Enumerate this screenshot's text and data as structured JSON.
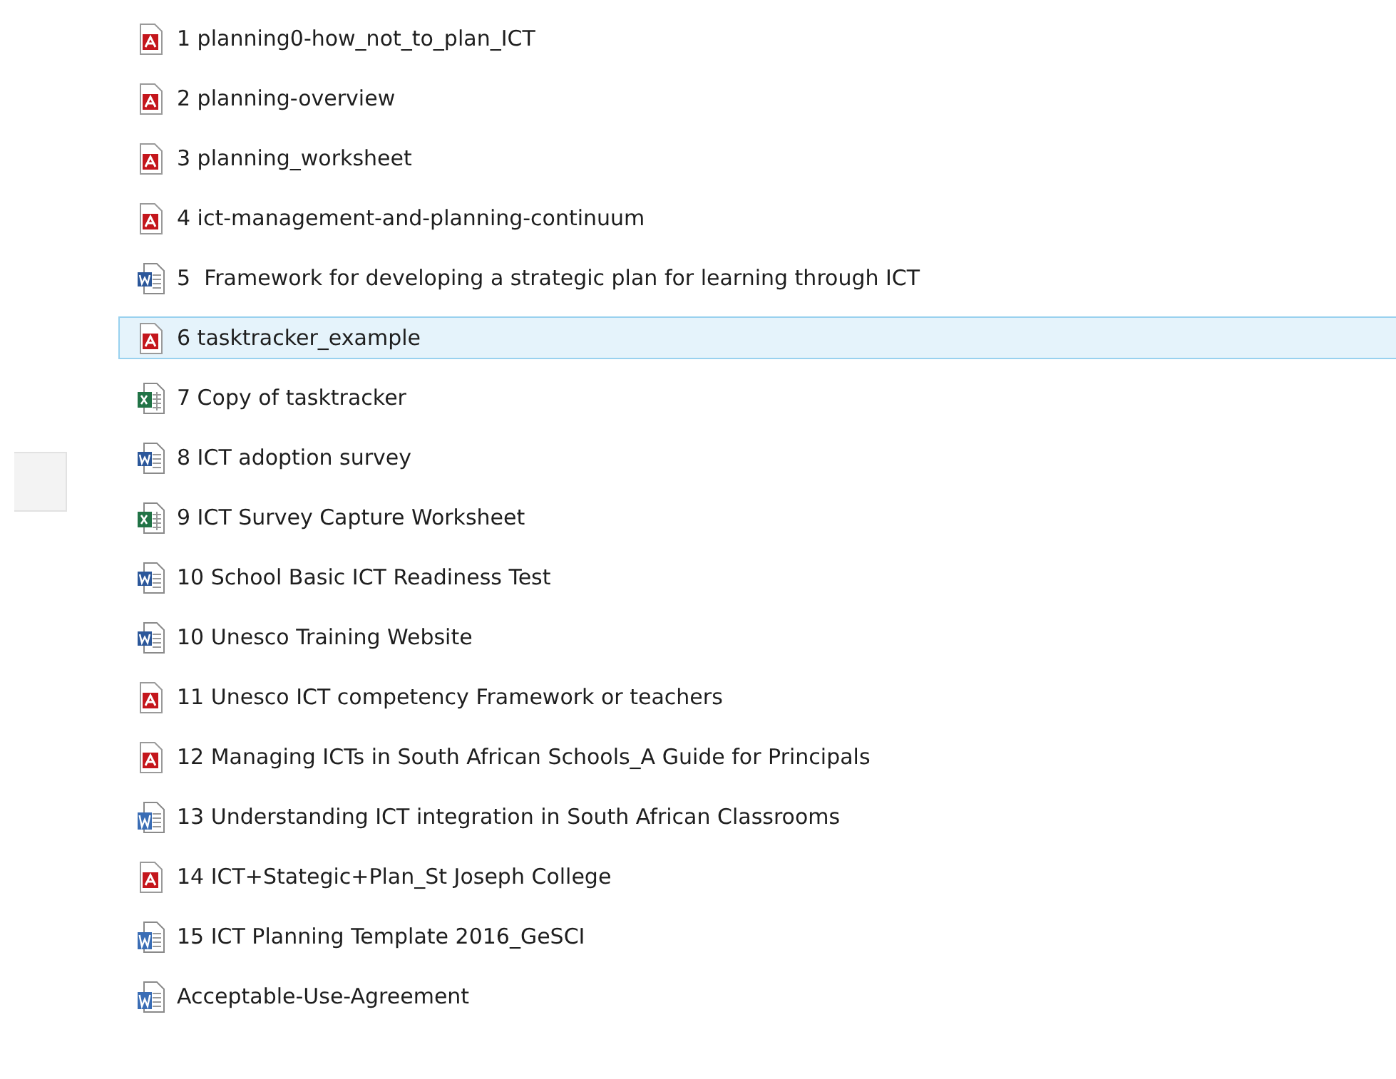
{
  "files": [
    {
      "name": "1 planning0-how_not_to_plan_ICT",
      "kind": "pdf",
      "selected": false
    },
    {
      "name": "2 planning-overview",
      "kind": "pdf",
      "selected": false
    },
    {
      "name": "3 planning_worksheet",
      "kind": "pdf",
      "selected": false
    },
    {
      "name": "4 ict-management-and-planning-continuum",
      "kind": "pdf",
      "selected": false
    },
    {
      "name": "5  Framework for developing a strategic plan for learning through ICT",
      "kind": "word",
      "selected": false
    },
    {
      "name": "6 tasktracker_example",
      "kind": "pdf",
      "selected": true
    },
    {
      "name": "7 Copy of tasktracker",
      "kind": "excel",
      "selected": false
    },
    {
      "name": "8 ICT adoption survey",
      "kind": "word",
      "selected": false
    },
    {
      "name": "9 ICT Survey Capture Worksheet",
      "kind": "excel",
      "selected": false
    },
    {
      "name": "10 School Basic ICT Readiness Test",
      "kind": "word",
      "selected": false
    },
    {
      "name": "10 Unesco Training Website",
      "kind": "word",
      "selected": false
    },
    {
      "name": "11 Unesco ICT competency Framework or teachers",
      "kind": "pdf",
      "selected": false
    },
    {
      "name": "12 Managing ICTs in South African Schools_A Guide for Principals",
      "kind": "pdf",
      "selected": false
    },
    {
      "name": "13 Understanding ICT integration in South African Classrooms",
      "kind": "word-legacy",
      "selected": false
    },
    {
      "name": "14 ICT+Stategic+Plan_St Joseph College",
      "kind": "pdf",
      "selected": false
    },
    {
      "name": "15 ICT Planning Template 2016_GeSCI",
      "kind": "word-legacy",
      "selected": false
    },
    {
      "name": "Acceptable-Use-Agreement",
      "kind": "word-legacy",
      "selected": false
    }
  ]
}
